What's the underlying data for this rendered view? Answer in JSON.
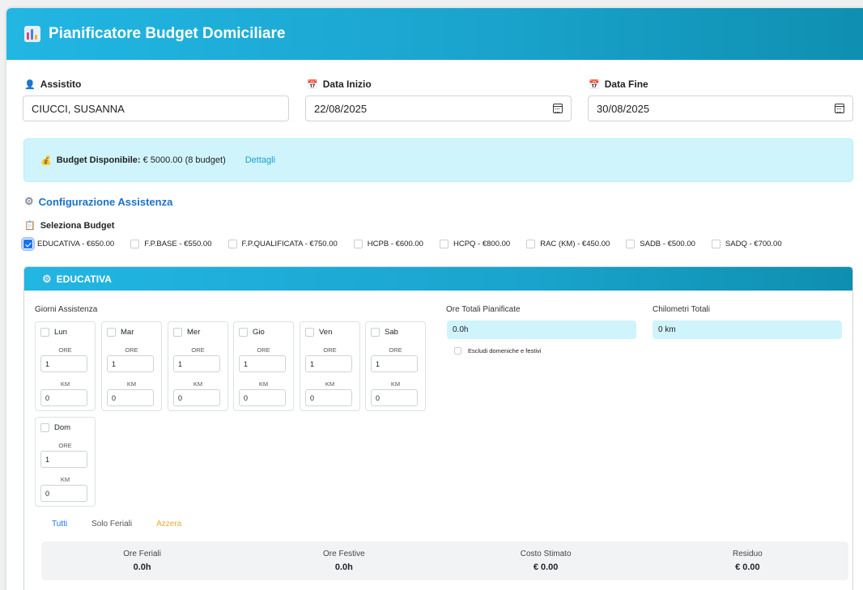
{
  "app": {
    "title": "Pianificatore Budget Domiciliare"
  },
  "fields": {
    "assistito": {
      "label": "Assistito",
      "value": "CIUCCI, SUSANNA"
    },
    "data_inizio": {
      "label": "Data Inizio",
      "value": "22/08/2025"
    },
    "data_fine": {
      "label": "Data Fine",
      "value": "30/08/2025"
    }
  },
  "budget": {
    "label": "Budget Disponibile:",
    "value": "€ 5000.00 (8 budget)",
    "details_link": "Dettagli"
  },
  "config": {
    "title": "Configurazione Assistenza",
    "select_title": "Seleziona Budget",
    "options": [
      {
        "label": "EDUCATIVA - €650.00",
        "checked": true
      },
      {
        "label": "F.P.BASE - €550.00",
        "checked": false
      },
      {
        "label": "F.P.QUALIFICATA - €750.00",
        "checked": false
      },
      {
        "label": "HCPB - €600.00",
        "checked": false
      },
      {
        "label": "HCPQ - €800.00",
        "checked": false
      },
      {
        "label": "RAC (KM) - €450.00",
        "checked": false
      },
      {
        "label": "SADB - €500.00",
        "checked": false
      },
      {
        "label": "SADQ - €700.00",
        "checked": false
      }
    ]
  },
  "panel": {
    "title": "EDUCATIVA",
    "days_label": "Giorni Assistenza",
    "ore_label": "ORE",
    "km_label": "KM",
    "days": [
      {
        "name": "Lun",
        "ore": "1",
        "km": "0"
      },
      {
        "name": "Mar",
        "ore": "1",
        "km": "0"
      },
      {
        "name": "Mer",
        "ore": "1",
        "km": "0"
      },
      {
        "name": "Gio",
        "ore": "1",
        "km": "0"
      },
      {
        "name": "Ven",
        "ore": "1",
        "km": "0"
      },
      {
        "name": "Sab",
        "ore": "1",
        "km": "0"
      },
      {
        "name": "Dom",
        "ore": "1",
        "km": "0"
      }
    ],
    "ore_totali_label": "Ore Totali Pianificate",
    "ore_totali_value": "0.0h",
    "km_totali_label": "Chilometri Totali",
    "km_totali_value": "0 km",
    "exclude_label": "Escludi domeniche e festivi",
    "actions": {
      "all": "Tutti",
      "weekdays": "Solo Feriali",
      "reset": "Azzera"
    },
    "summary": [
      {
        "label": "Ore Feriali",
        "value": "0.0h"
      },
      {
        "label": "Ore Festive",
        "value": "0.0h"
      },
      {
        "label": "Costo Stimato",
        "value": "€ 0.00"
      },
      {
        "label": "Residuo",
        "value": "€ 0.00"
      }
    ]
  },
  "colors": {
    "header": "#1aa4cd",
    "info_bg": "#cff4fc",
    "link": "#17a2c8",
    "section_title": "#1a73c9",
    "reset": "#f0a830"
  },
  "icons": {
    "title": "bar-chart-icon",
    "assistito": "user-icon",
    "date": "calendar-icon",
    "budget": "money-bag-icon",
    "config": "gear-icon",
    "select": "clipboard-icon"
  }
}
